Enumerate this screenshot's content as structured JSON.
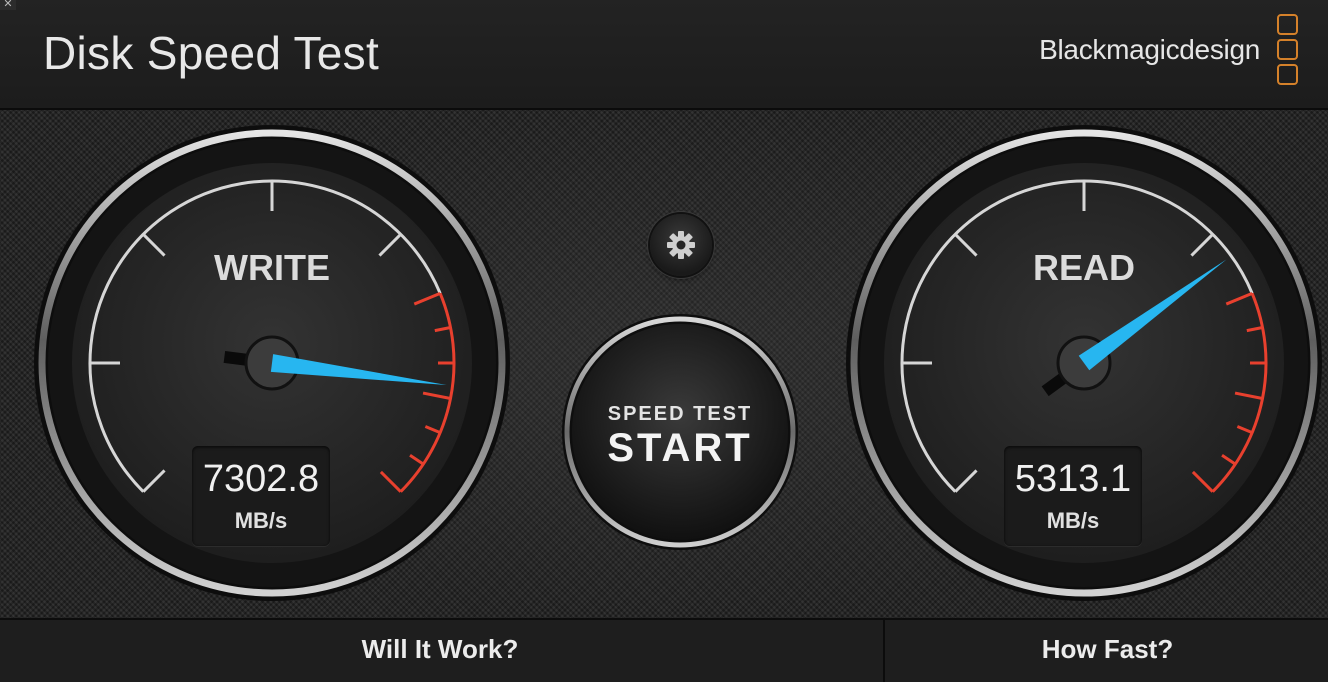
{
  "window": {
    "close_glyph": "✕"
  },
  "header": {
    "title": "Disk Speed Test",
    "brand": "Blackmagicdesign"
  },
  "gauges": {
    "write": {
      "label": "WRITE",
      "value": "7302.8",
      "unit": "MB/s",
      "needle_fraction": 0.86
    },
    "read": {
      "label": "READ",
      "value": "5313.1",
      "unit": "MB/s",
      "needle_fraction": 0.7
    }
  },
  "settings_button": {
    "icon": "gear-icon"
  },
  "start_button": {
    "line1": "SPEED TEST",
    "line2": "START"
  },
  "footer": {
    "tabs": [
      {
        "label": "Will It Work?"
      },
      {
        "label": "How Fast?"
      }
    ]
  },
  "colors": {
    "needle": "#27b6f0",
    "redline": "#e8402e",
    "logo": "#d5812a"
  }
}
